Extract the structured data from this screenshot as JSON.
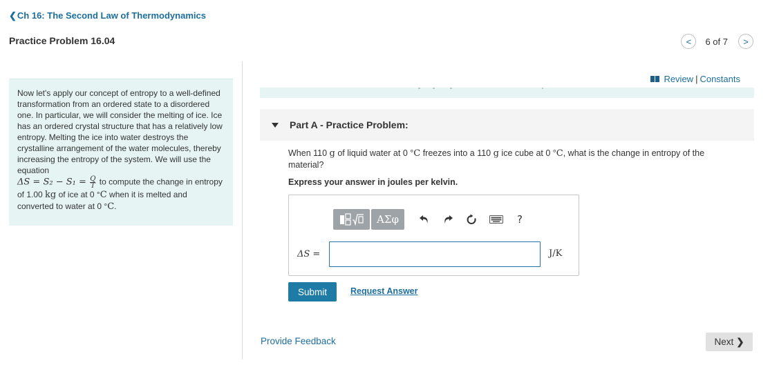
{
  "nav": {
    "back_chevron": "❮",
    "chapter_link": "Ch 16: The Second Law of Thermodynamics"
  },
  "problem": {
    "title": "Practice Problem 16.04"
  },
  "pager": {
    "prev_symbol": "<",
    "next_symbol": ">",
    "position_text": "6 of 7"
  },
  "intro": {
    "text_1": "Now let's apply our concept of entropy to a well-defined transformation from an ordered state to a disordered one. In particular, we will consider the melting of ice. Ice has an ordered crystal structure that has a relatively low entropy. Melting the ice into water destroys the crystalline arrangement of the water molecules, thereby increasing the entropy of the system. We will use the equation",
    "equation": "ΔS = S₂ − S₁ =",
    "frac_num": "Q",
    "frac_den": "T",
    "text_2": " to compute the change in entropy of 1.00 ",
    "unit_kg": "kg",
    "text_3": " of ice at 0 °",
    "unit_c": "C",
    "text_4": " when it is melted and converted to water at 0 °",
    "unit_c2": "C",
    "text_5": "."
  },
  "review": {
    "review_label": "Review",
    "separator": "|",
    "constants_label": "Constants"
  },
  "part": {
    "title": "Part A - Practice Problem:"
  },
  "question": {
    "t1": "When 110 ",
    "u1": "g",
    "t2": " of liquid water at 0 °",
    "u2": "C",
    "t3": " freezes into a 110 ",
    "u3": "g",
    "t4": " ice cube at 0 °",
    "u4": "C",
    "t5": ", what is the change in entropy of the material?"
  },
  "instruction": "Express your answer in joules per kelvin.",
  "toolbar": {
    "greek_label": "ΑΣφ",
    "help_label": "?"
  },
  "answer": {
    "label": "ΔS =",
    "value": "",
    "unit": "J/K"
  },
  "actions": {
    "submit_label": "Submit",
    "request_label": "Request Answer",
    "feedback_label": "Provide Feedback",
    "next_label": "Next",
    "next_chevron": "❯"
  },
  "colors": {
    "link": "#1c6e9c",
    "intro_bg": "#e6f5f3",
    "submit_bg": "#1d7ba5",
    "toolbar_btn": "#9ea3a7"
  }
}
